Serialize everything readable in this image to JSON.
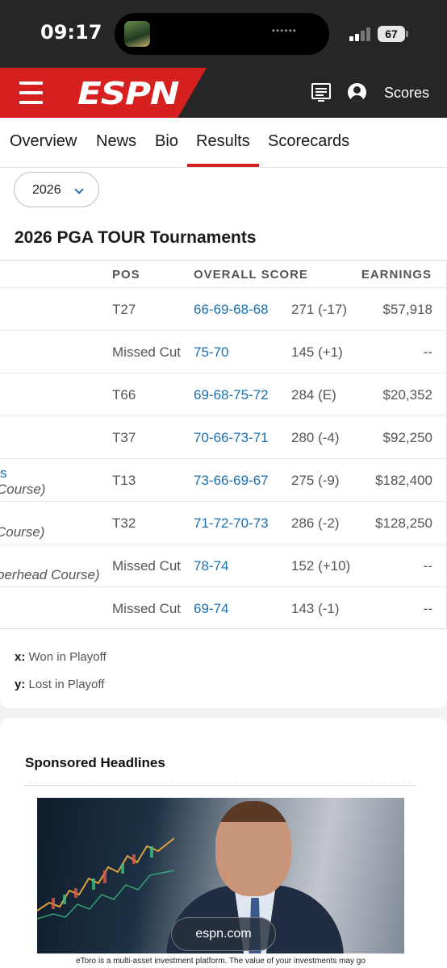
{
  "status_bar": {
    "time": "09:17",
    "battery": "67",
    "island_dots": "••••••"
  },
  "header": {
    "logo": "ESPN",
    "scores_label": "Scores",
    "colors": {
      "brand_red": "#d6201f",
      "bar": "#262626"
    }
  },
  "tabs": [
    {
      "label": "Overview"
    },
    {
      "label": "News"
    },
    {
      "label": "Bio"
    },
    {
      "label": "Results",
      "active": true
    },
    {
      "label": "Scorecards"
    }
  ],
  "year_selector": {
    "value": "2026"
  },
  "section_title": "2026 PGA TOUR Tournaments",
  "table": {
    "headers": {
      "pos": "POS",
      "overall_score": "OVERALL SCORE",
      "earnings": "EARNINGS"
    },
    "rows": [
      {
        "tournament": "",
        "pos": "T27",
        "rounds": "66-69-68-68",
        "total": "271 (-17)",
        "earnings": "$57,918"
      },
      {
        "tournament": "",
        "pos": "Missed Cut",
        "rounds": "75-70",
        "total": "145 (+1)",
        "earnings": "--"
      },
      {
        "tournament": "",
        "pos": "T66",
        "rounds": "69-68-75-72",
        "total": "284 (E)",
        "earnings": "$20,352"
      },
      {
        "tournament": "",
        "pos": "T37",
        "rounds": "70-66-73-71",
        "total": "280 (-4)",
        "earnings": "$92,250"
      },
      {
        "tournament": "s",
        "tournament_sub": "Course)",
        "pos": "T13",
        "rounds": "73-66-69-67",
        "total": "275 (-9)",
        "earnings": "$182,400"
      },
      {
        "tournament": "",
        "tournament_sub": "Course)",
        "pos": "T32",
        "rounds": "71-72-70-73",
        "total": "286 (-2)",
        "earnings": "$128,250"
      },
      {
        "tournament": "",
        "tournament_sub": "perhead Course)",
        "pos": "Missed Cut",
        "rounds": "78-74",
        "total": "152 (+10)",
        "earnings": "--"
      },
      {
        "tournament": "",
        "pos": "Missed Cut",
        "rounds": "69-74",
        "total": "143 (-1)",
        "earnings": "--"
      }
    ]
  },
  "legend": [
    {
      "key": "x:",
      "text": "Won in Playoff"
    },
    {
      "key": "y:",
      "text": "Lost in Playoff"
    }
  ],
  "sponsored": {
    "title": "Sponsored Headlines",
    "ad_url": "espn.com",
    "disclaimer": "eToro is a multi-asset investment platform. The value of your investments may go"
  }
}
